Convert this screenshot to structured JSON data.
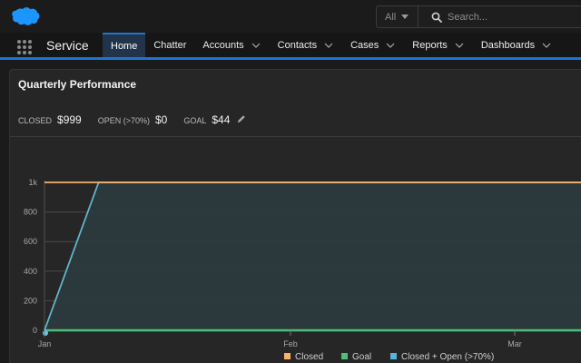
{
  "header": {
    "logo_icon": "salesforce-cloud-icon",
    "brand_color": "#1b96ff",
    "search": {
      "scope": "All",
      "placeholder": "Search..."
    }
  },
  "nav": {
    "app_name": "Service",
    "tabs": [
      {
        "label": "Home",
        "active": true,
        "has_menu": false
      },
      {
        "label": "Chatter",
        "active": false,
        "has_menu": false
      },
      {
        "label": "Accounts",
        "active": false,
        "has_menu": true
      },
      {
        "label": "Contacts",
        "active": false,
        "has_menu": true
      },
      {
        "label": "Cases",
        "active": false,
        "has_menu": true
      },
      {
        "label": "Reports",
        "active": false,
        "has_menu": true
      },
      {
        "label": "Dashboards",
        "active": false,
        "has_menu": true
      }
    ]
  },
  "card": {
    "title": "Quarterly Performance",
    "stats": [
      {
        "label": "CLOSED",
        "value": "$999"
      },
      {
        "label": "OPEN (>70%)",
        "value": "$0"
      },
      {
        "label": "GOAL",
        "value": "$44"
      }
    ]
  },
  "chart_data": {
    "type": "line",
    "x_ticks": [
      "Jan",
      "Feb",
      "Mar"
    ],
    "y_ticks": [
      "0",
      "200",
      "400",
      "600",
      "800",
      "1k"
    ],
    "ylim": [
      0,
      1000
    ],
    "grid": true,
    "legend_position": "bottom",
    "series": [
      {
        "name": "Closed",
        "color": "#f9b26a",
        "points": [
          [
            "Jan",
            0
          ],
          [
            "Jan",
            1000
          ],
          [
            "Mar",
            1000
          ]
        ]
      },
      {
        "name": "Goal",
        "color": "#4bc076",
        "points": [
          [
            "Jan",
            0
          ],
          [
            "Mar",
            0
          ]
        ]
      },
      {
        "name": "Closed + Open (>70%)",
        "color": "#54b7d9",
        "points": [
          [
            "Jan",
            0
          ],
          [
            "Jan",
            1000
          ],
          [
            "Mar",
            1000
          ]
        ]
      }
    ]
  }
}
